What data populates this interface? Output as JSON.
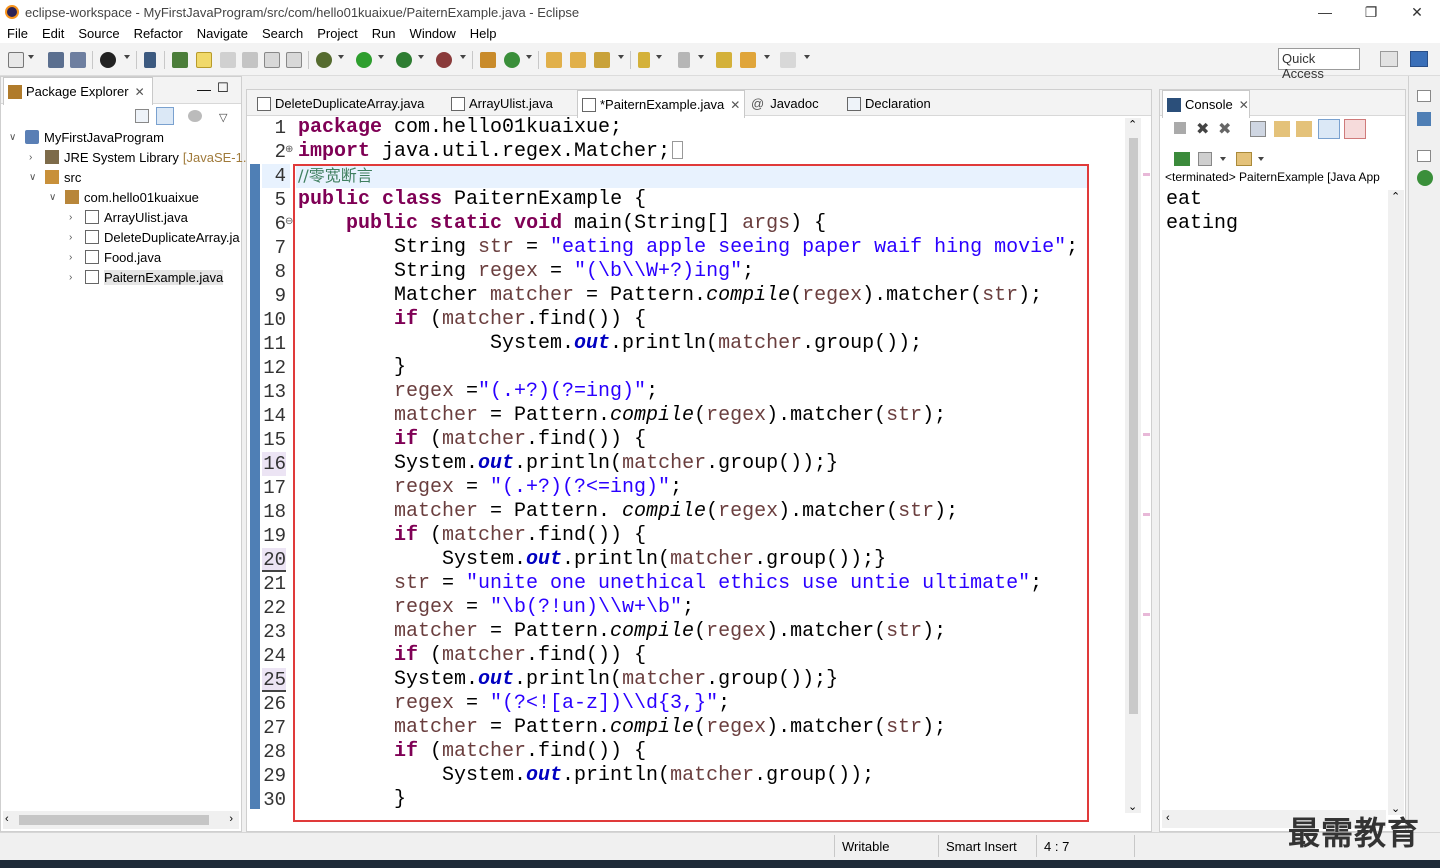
{
  "window": {
    "title": "eclipse-workspace - MyFirstJavaProgram/src/com/hello01kuaixue/PaiternExample.java - Eclipse",
    "minimize": "—",
    "restore": "❐",
    "close": "✕"
  },
  "menu": [
    "File",
    "Edit",
    "Source",
    "Refactor",
    "Navigate",
    "Search",
    "Project",
    "Run",
    "Window",
    "Help"
  ],
  "quick_access": "Quick Access",
  "package_explorer": {
    "tab_label": "Package Explorer",
    "tree": [
      {
        "label": "MyFirstJavaProgram",
        "extra": ""
      },
      {
        "label": "JRE System Library",
        "extra": "[JavaSE-1."
      },
      {
        "label": "src",
        "extra": ""
      },
      {
        "label": "com.hello01kuaixue",
        "extra": ""
      },
      {
        "label": "ArrayUlist.java",
        "extra": ""
      },
      {
        "label": "DeleteDuplicateArray.ja",
        "extra": ""
      },
      {
        "label": "Food.java",
        "extra": ""
      },
      {
        "label": "PaiternExample.java",
        "extra": ""
      }
    ]
  },
  "editor_tabs": [
    {
      "label": "DeleteDuplicateArray.java",
      "active": false
    },
    {
      "label": "ArrayUlist.java",
      "active": false
    },
    {
      "label": "*PaiternExample.java",
      "active": true
    },
    {
      "label": "Javadoc",
      "active": false
    },
    {
      "label": "Declaration",
      "active": false
    }
  ],
  "editor": {
    "line_numbers": [
      "1",
      "2",
      "4",
      "5",
      "6",
      "7",
      "8",
      "9",
      "10",
      "11",
      "12",
      "13",
      "14",
      "15",
      "16",
      "17",
      "18",
      "19",
      "20",
      "21",
      "22",
      "23",
      "24",
      "25",
      "26",
      "27",
      "28",
      "29",
      "30"
    ],
    "fold_markers": {
      "line2": "⊕",
      "line6": "⊖"
    },
    "code": {
      "l1_kw": "package",
      "l1_rest": " com.hello01kuaixue;",
      "l2_kw": "import",
      "l2_rest": " java.util.regex.Matcher;",
      "l4_comment": "//零宽断言",
      "l5_kw1": "public",
      "l5_kw2": "class",
      "l5_rest": " PaiternExample {",
      "l6_kw1": "public",
      "l6_kw2": "static",
      "l6_kw3": "void",
      "l6_rest1": " main(String[] ",
      "l6_var": "args",
      "l6_rest2": ") {",
      "l7_a": "String ",
      "l7_var": "str",
      "l7_b": " = ",
      "l7_str": "\"eating apple seeing paper waif hing movie\"",
      "l7_c": ";",
      "l8_a": "String ",
      "l8_var": "regex",
      "l8_b": " = ",
      "l8_str": "\"(\\b\\\\W+?)ing\"",
      "l8_c": ";",
      "l9_a": "Matcher ",
      "l9_var": "matcher",
      "l9_b": " = Pattern.",
      "l9_it": "compile",
      "l9_c": "(",
      "l9_var2": "regex",
      "l9_d": ").matcher(",
      "l9_var3": "str",
      "l9_e": ");",
      "if_kw": "if",
      "find_a": " (",
      "find_var": "matcher",
      "find_b": ".find()) {",
      "sys": "System.",
      "out": "out",
      "println": ".println(",
      "group_var": "matcher",
      "group": ".group());",
      "group_brace": ".group());}",
      "close_brace": "}",
      "l13_var": "regex",
      "l13_b": " =",
      "l13_str": "\"(.+?)(?=ing)\"",
      "l13_c": ";",
      "l14_var": "matcher",
      "l14_b": " = Pattern.",
      "l14_it": "compile",
      "l14_c": "(",
      "l14_var2": "regex",
      "l14_d": ").matcher(",
      "l14_var3": "str",
      "l14_e": ");",
      "l17_var": "regex",
      "l17_b": " = ",
      "l17_str": "\"(.+?)(?<=ing)\"",
      "l17_c": ";",
      "l18_var": "matcher",
      "l18_b": " = Pattern. ",
      "l18_it": "compile",
      "l18_c": "(",
      "l18_var2": "regex",
      "l18_d": ").matcher(",
      "l18_var3": "str",
      "l18_e": ");",
      "l21_var": "str",
      "l21_b": " = ",
      "l21_str": "\"unite one unethical ethics use untie ultimate\"",
      "l21_c": ";",
      "l22_var": "regex",
      "l22_b": " = ",
      "l22_str": "\"\\b(?!un)\\\\w+\\b\"",
      "l22_c": ";",
      "l26_var": "regex",
      "l26_b": " = ",
      "l26_str": "\"(?<![a-z])\\\\d{3,}\"",
      "l26_c": ";"
    }
  },
  "console": {
    "tab_label": "Console",
    "terminated": "<terminated> PaiternExample [Java App",
    "output": [
      "eat",
      "eating"
    ]
  },
  "status": {
    "writable": "Writable",
    "insert_mode": "Smart Insert",
    "position": "4 : 7"
  },
  "watermark": "最需教育",
  "colors": {
    "keyword": "#7f0055",
    "string": "#2a00ff",
    "comment": "#3f7f5f",
    "field": "#0000c0",
    "highlight_box": "#e03a3a"
  }
}
